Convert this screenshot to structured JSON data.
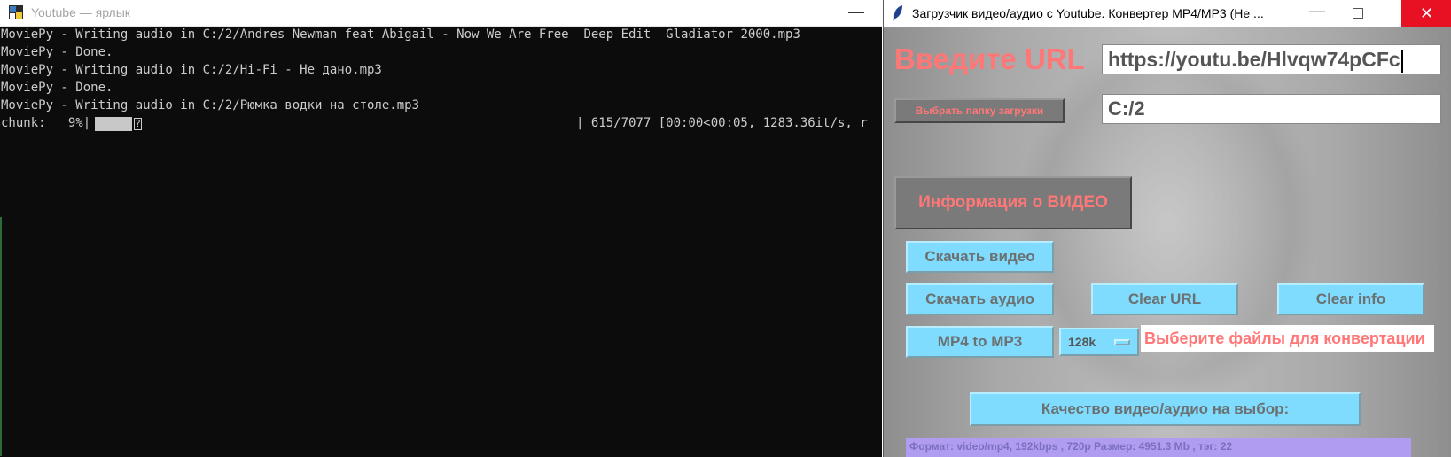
{
  "console": {
    "title": "Youtube — ярлык",
    "minimize_glyph": "—",
    "lines": [
      "MoviePy - Writing audio in C:/2/Andres Newman feat Abigail - Now We Are Free  Deep Edit  Gladiator 2000.mp3",
      "MoviePy - Done.",
      "MoviePy - Writing audio in C:/2/Hi-Fi - Не дано.mp3",
      "MoviePy - Done.",
      "MoviePy - Writing audio in C:/2/Рюмка водки на столе.mp3"
    ],
    "progress": {
      "label": "chunk:   9%|",
      "percent": 9,
      "glyph": "?",
      "stats": "| 615/7077 [00:00<00:05, 1283.36it/s, r"
    }
  },
  "app": {
    "title": "Загрузчик видео/аудио с Youtube. Конвертер MP4/MP3 (Не ...",
    "close_glyph": "✕",
    "minimize_glyph": "—",
    "heading": "Введите URL",
    "url_value": "https://youtu.be/Hlvqw74pCFc",
    "folder_button": "Выбрать папку загрузки",
    "folder_value": "C:/2",
    "info_button": "Информация о ВИДЕО",
    "download_video": "Скачать видео",
    "download_audio": "Скачать аудио",
    "clear_url": "Clear URL",
    "clear_info": "Clear info",
    "mp4_to_mp3": "MP4 to MP3",
    "bitrate": "128k",
    "convert_label": "Выберите файлы для конвертации",
    "quality_button": "Качество видео/аудио на выбор:",
    "format_item": "Формат: video/mp4, 192kbps , 720p Размер:  4951.3 Mb , тэг: 22"
  },
  "colors": {
    "accent_red": "#ff7777",
    "button_cyan": "#7fdcff",
    "console_bg": "#0c0c0c",
    "close_red": "#e81123"
  }
}
